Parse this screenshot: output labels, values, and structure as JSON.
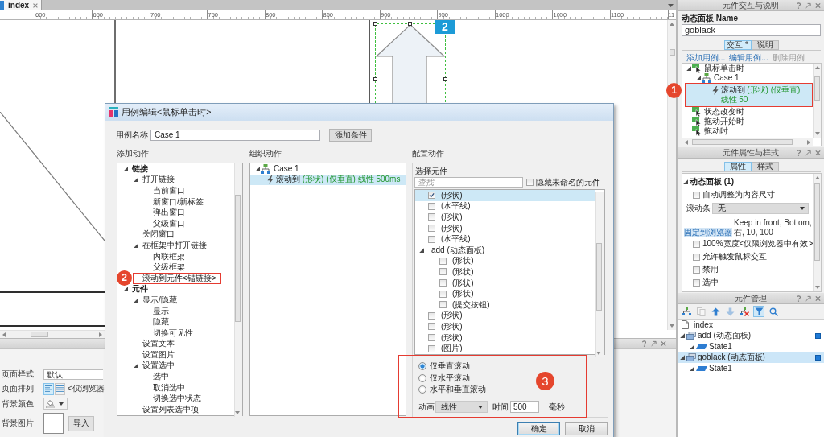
{
  "canvas_tab": {
    "label": "index"
  },
  "ruler": {
    "labels": [
      "600",
      "650",
      "700",
      "750",
      "800",
      "850",
      "900",
      "950",
      "1000",
      "1050",
      "1100",
      "11"
    ]
  },
  "canvas": {
    "marker": "2"
  },
  "page_panel": {
    "rows": [
      {
        "kind": "select",
        "label": "页面样式",
        "value": "默认"
      },
      {
        "kind": "align",
        "label": "页面排列",
        "options": [
          {
            "selected": true
          },
          {
            "selected": false
          }
        ],
        "note": "<仅浏览器"
      },
      {
        "kind": "color",
        "label": "背景颜色"
      },
      {
        "kind": "image",
        "label": "背景图片",
        "button": "导入"
      }
    ]
  },
  "dialog": {
    "title": "用例编辑<鼠标单击时>",
    "name_label": "用例名称",
    "name_value": "Case 1",
    "add_condition": "添加条件",
    "add_action": {
      "heading": "添加动作",
      "tree": [
        {
          "label": "链接",
          "expanded": true,
          "children": [
            {
              "label": "打开链接",
              "expanded": true,
              "children": [
                {
                  "label": "当前窗口"
                },
                {
                  "label": "新窗口/新标签"
                },
                {
                  "label": "弹出窗口"
                },
                {
                  "label": "父级窗口"
                }
              ]
            },
            {
              "label": "关闭窗口"
            },
            {
              "label": "在框架中打开链接",
              "expanded": true,
              "children": [
                {
                  "label": "内联框架"
                },
                {
                  "label": "父级框架"
                }
              ]
            },
            {
              "label": "滚动到元件<锚链接>",
              "callout": "2"
            }
          ]
        },
        {
          "label": "元件",
          "expanded": true,
          "children": [
            {
              "label": "显示/隐藏",
              "expanded": true,
              "children": [
                {
                  "label": "显示"
                },
                {
                  "label": "隐藏"
                },
                {
                  "label": "切换可见性"
                }
              ]
            },
            {
              "label": "设置文本"
            },
            {
              "label": "设置图片"
            },
            {
              "label": "设置选中",
              "expanded": true,
              "children": [
                {
                  "label": "选中"
                },
                {
                  "label": "取消选中"
                },
                {
                  "label": "切换选中状态"
                }
              ]
            },
            {
              "label": "设置列表选中项"
            }
          ]
        }
      ]
    },
    "organize": {
      "heading": "组织动作",
      "cases": [
        {
          "label": "Case 1",
          "expanded": true,
          "actions": [
            {
              "verb": "滚动到",
              "detail": "(形状) (仅垂直) 线性 500ms",
              "selected": true
            }
          ]
        }
      ]
    },
    "configure": {
      "heading": "配置动作",
      "group_label": "选择元件",
      "search_placeholder": "查找",
      "hide_unnamed": {
        "label": "隐藏未命名的元件",
        "checked": false
      },
      "widgets": [
        {
          "kind": "widget",
          "label": "(形状)",
          "checked": true,
          "selected": true
        },
        {
          "kind": "widget",
          "label": "(水平线)",
          "checked": false,
          "selected": false
        },
        {
          "kind": "widget",
          "label": "(形状)",
          "checked": false,
          "selected": false
        },
        {
          "kind": "widget",
          "label": "(形状)",
          "checked": false,
          "selected": false
        },
        {
          "kind": "widget",
          "label": "(水平线)",
          "checked": false,
          "selected": false
        },
        {
          "kind": "group",
          "label": "add (动态面板)",
          "expanded": true,
          "selected": false,
          "children": [
            {
              "kind": "widget",
              "label": "(形状)",
              "checked": false,
              "selected": false
            },
            {
              "kind": "widget",
              "label": "(形状)",
              "checked": false,
              "selected": false
            },
            {
              "kind": "widget",
              "label": "(形状)",
              "checked": false,
              "selected": false
            },
            {
              "kind": "widget",
              "label": "(形状)",
              "checked": false,
              "selected": false
            },
            {
              "kind": "widget",
              "label": "(提交按钮)",
              "checked": false,
              "selected": false
            }
          ]
        },
        {
          "kind": "widget",
          "label": "(形状)",
          "checked": false,
          "selected": false
        },
        {
          "kind": "widget",
          "label": "(形状)",
          "checked": false,
          "selected": false
        },
        {
          "kind": "widget",
          "label": "(形状)",
          "checked": false,
          "selected": false
        },
        {
          "kind": "widget",
          "label": "(图片)",
          "checked": false,
          "selected": false
        }
      ],
      "scroll_options": [
        {
          "label": "仅垂直滚动",
          "selected": true
        },
        {
          "label": "仅水平滚动",
          "selected": false
        },
        {
          "label": "水平和垂直滚动",
          "selected": false
        }
      ],
      "animation_label": "动画",
      "animation_value": "线性",
      "time_label": "时间",
      "time_value": "500",
      "time_unit": "毫秒",
      "callout": "3"
    },
    "buttons": [
      {
        "kind": "primary",
        "label": "确定"
      },
      {
        "kind": "secondary",
        "label": "取消"
      }
    ]
  },
  "interactions": {
    "title": "元件交互与说明",
    "name_label": "动态面板 Name",
    "name_value": "goblack",
    "tabs": [
      {
        "label": "交互 *",
        "selected": true
      },
      {
        "label": "说明",
        "selected": false
      }
    ],
    "links": [
      {
        "label": "添加用例...",
        "disabled": false
      },
      {
        "label": "编辑用例...",
        "disabled": false
      },
      {
        "label": "删除用例",
        "disabled": true
      }
    ],
    "events": [
      {
        "label": "鼠标单击时",
        "expanded": true,
        "cases": [
          {
            "label": "Case 1",
            "expanded": true,
            "actions": [
              {
                "verb": "滚动到",
                "detail": "(形状) (仅垂直) 线性 50",
                "selected": true,
                "callout": "1"
              }
            ]
          }
        ]
      },
      {
        "label": "状态改变时"
      },
      {
        "label": "拖动开始时"
      },
      {
        "label": "拖动时"
      }
    ]
  },
  "properties": {
    "title": "元件属性与样式",
    "tabs": [
      {
        "label": "属性",
        "selected": true
      },
      {
        "label": "样式",
        "selected": false
      }
    ],
    "section": {
      "label": "动态面板 (1)",
      "expanded": true
    },
    "options": [
      {
        "kind": "checkbox",
        "label": "自动调整为内容尺寸",
        "checked": false
      },
      {
        "kind": "select",
        "label": "滚动条",
        "value": "无"
      },
      {
        "kind": "pin",
        "link": "固定到浏览器",
        "text": "Keep in front, Bottom, 右, 10, 100"
      },
      {
        "kind": "checkbox",
        "label": "100%宽度<仅限浏览器中有效>",
        "checked": false
      },
      {
        "kind": "checkbox",
        "label": "允许触发鼠标交互",
        "checked": false
      },
      {
        "kind": "checkbox",
        "label": "禁用",
        "checked": false
      },
      {
        "kind": "checkbox",
        "label": "选中",
        "checked": false
      }
    ]
  },
  "outline": {
    "title": "元件管理",
    "toolbar": [
      {
        "on": false,
        "disabled": false
      },
      {
        "on": false,
        "disabled": true
      },
      {
        "on": false,
        "disabled": false
      },
      {
        "on": false,
        "disabled": true
      },
      {
        "on": false,
        "disabled": false
      },
      {
        "on": true,
        "disabled": false
      },
      {
        "on": false,
        "disabled": false
      }
    ],
    "page": "index",
    "widgets": [
      {
        "kind": "panel",
        "label": "add (动态面板)",
        "expanded": true,
        "selected": false,
        "children": [
          {
            "kind": "state",
            "label": "State1",
            "expanded": true,
            "selected": false
          }
        ]
      },
      {
        "kind": "panel",
        "label": "goblack (动态面板)",
        "expanded": true,
        "selected": true,
        "children": [
          {
            "kind": "state",
            "label": "State1",
            "expanded": true,
            "selected": false
          }
        ]
      }
    ]
  }
}
